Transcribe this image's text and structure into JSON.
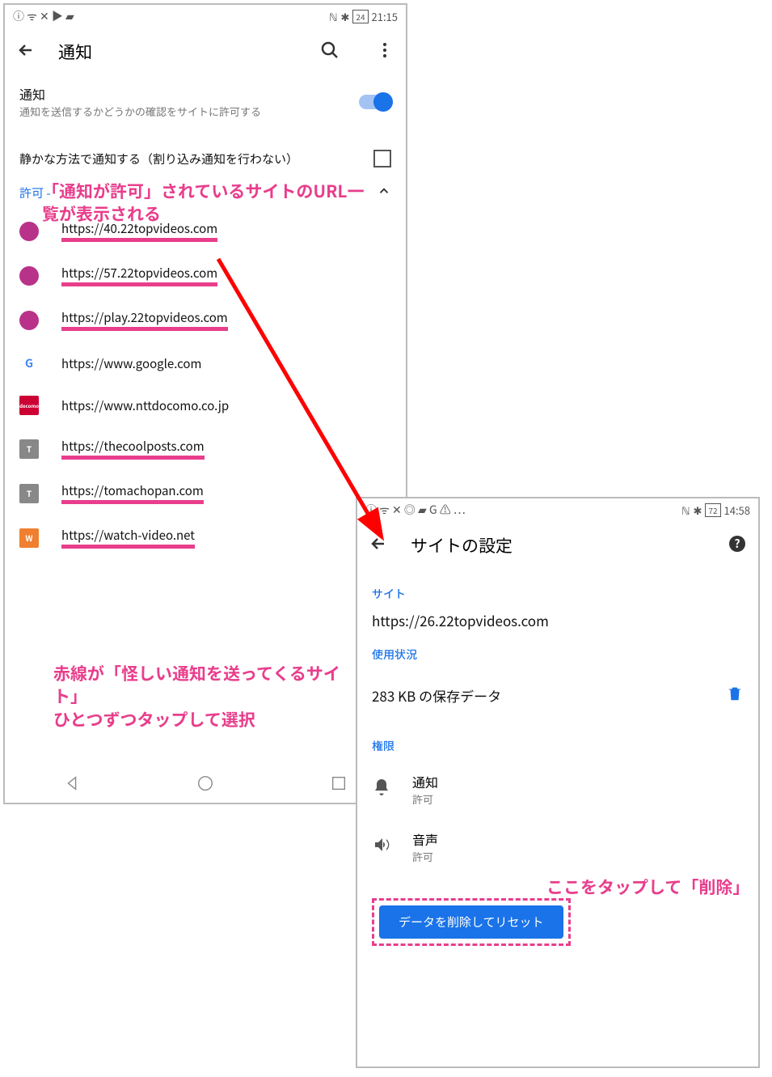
{
  "phone1": {
    "status": {
      "left": "ⓘ ᯤ ✕ ▶ ▰",
      "battery": "24",
      "time": "21:15"
    },
    "appbar": {
      "title": "通知"
    },
    "notif": {
      "title": "通知",
      "subtitle": "通知を送信するかどうかの確認をサイトに許可する"
    },
    "quiet": {
      "label": "静かな方法で通知する（割り込み通知を行わない）"
    },
    "allow_header": "許可 - ",
    "sites": [
      {
        "url": "https://40.22topvideos.com",
        "favcolor": "#b83289",
        "mark": true,
        "badge": ""
      },
      {
        "url": "https://57.22topvideos.com",
        "favcolor": "#b83289",
        "mark": true,
        "badge": ""
      },
      {
        "url": "https://play.22topvideos.com",
        "favcolor": "#b83289",
        "mark": true,
        "badge": ""
      },
      {
        "url": "https://www.google.com",
        "favcolor": "#ffffff",
        "mark": false,
        "badge": "G"
      },
      {
        "url": "https://www.nttdocomo.co.jp",
        "favcolor": "#cc0033",
        "mark": false,
        "badge": ""
      },
      {
        "url": "https://thecoolposts.com",
        "favcolor": "#888888",
        "mark": true,
        "badge": "T"
      },
      {
        "url": "https://tomachopan.com",
        "favcolor": "#888888",
        "mark": true,
        "badge": "T"
      },
      {
        "url": "https://watch-video.net",
        "favcolor": "#f08030",
        "mark": true,
        "badge": "W"
      }
    ]
  },
  "phone2": {
    "status": {
      "left": "ⓘ ᯤ ✕ ◎ ▰ G ⚠ ⋯",
      "battery": "72",
      "time": "14:58"
    },
    "appbar": {
      "title": "サイトの設定"
    },
    "site_label": "サイト",
    "site_url": "https://26.22topvideos.com",
    "usage_label": "使用状況",
    "usage_text": "283 KB の保存データ",
    "perm_label": "権限",
    "perm_notif": {
      "title": "通知",
      "sub": "許可"
    },
    "perm_sound": {
      "title": "音声",
      "sub": "許可"
    },
    "delete_button": "データを削除してリセット"
  },
  "annotations": {
    "a1": "「通知が許可」されているサイトのURL一覧が表示される",
    "a2": "赤線が「怪しい通知を送ってくるサイト」\nひとつずつタップして選択",
    "a3": "ここをタップして「削除」"
  }
}
